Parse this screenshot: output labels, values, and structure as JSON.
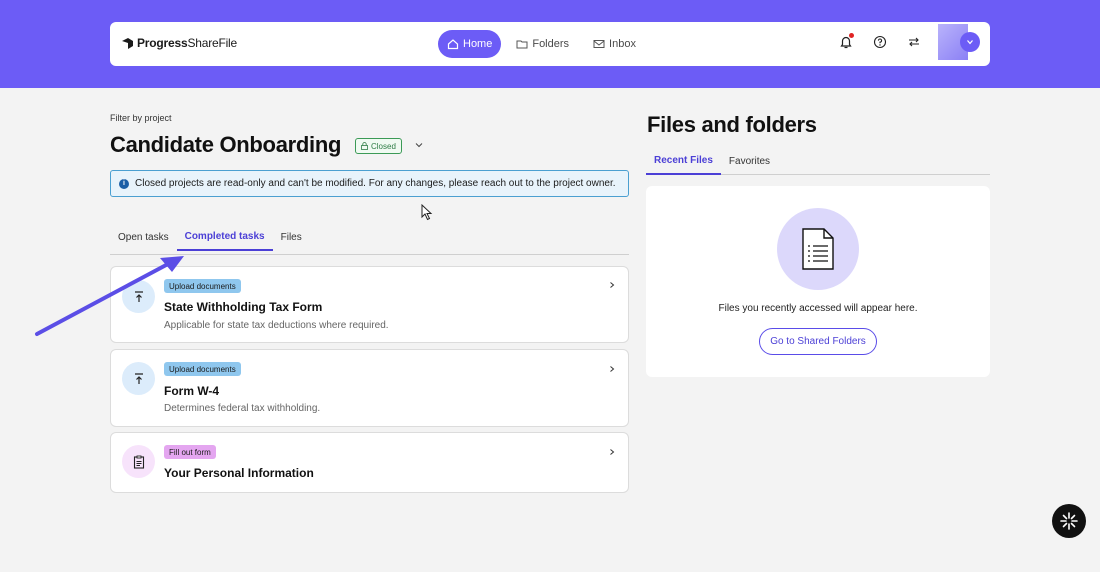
{
  "brand": {
    "name_bold": "Progress",
    "name_light": "ShareFile",
    "primary_color": "#6c5cf6",
    "accent_color": "#4b3fd6"
  },
  "nav": {
    "links": [
      {
        "label": "Home",
        "icon": "home-icon",
        "active": true
      },
      {
        "label": "Folders",
        "icon": "folder-icon",
        "active": false
      },
      {
        "label": "Inbox",
        "icon": "mail-icon",
        "active": false
      }
    ],
    "icons": [
      "bell-icon",
      "help-icon",
      "switch-icon",
      "avatar"
    ]
  },
  "project": {
    "filter_label": "Filter by project",
    "title": "Candidate Onboarding",
    "status": "Closed"
  },
  "alert": {
    "message": "Closed projects are read-only and can't be modified. For any changes, please reach out to the project owner."
  },
  "task_tabs": [
    {
      "label": "Open tasks",
      "active": false
    },
    {
      "label": "Completed tasks",
      "active": true
    },
    {
      "label": "Files",
      "active": false
    }
  ],
  "tasks": [
    {
      "badge": "Upload documents",
      "title": "State Withholding Tax Form",
      "description": "Applicable for state tax deductions where required.",
      "icon": "upload-icon"
    },
    {
      "badge": "Upload documents",
      "title": "Form W-4",
      "description": "Determines federal tax withholding.",
      "icon": "upload-icon"
    },
    {
      "badge": "Fill out form",
      "title": "Your Personal Information",
      "description": "",
      "icon": "clipboard-icon"
    }
  ],
  "files_panel": {
    "title": "Files and folders",
    "tabs": [
      {
        "label": "Recent Files",
        "active": true
      },
      {
        "label": "Favorites",
        "active": false
      }
    ],
    "empty_message": "Files you recently accessed will appear here.",
    "button_label": "Go to Shared Folders"
  }
}
